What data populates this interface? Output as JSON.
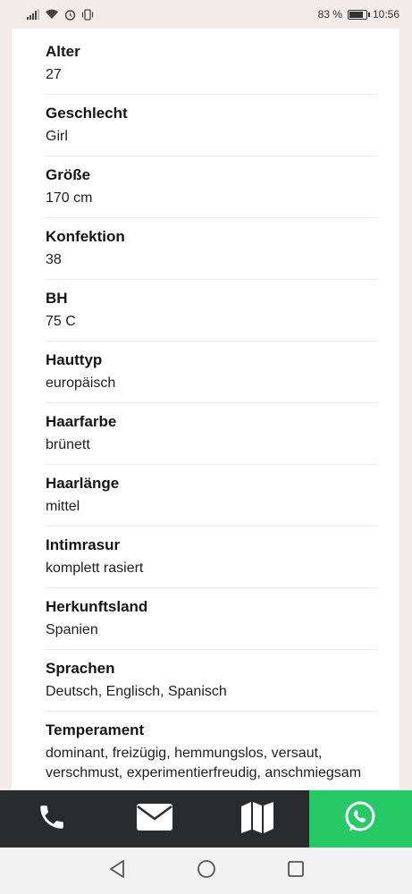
{
  "status_bar": {
    "battery_percent": "83 %",
    "time": "10:56",
    "battery_level": 0.83,
    "icons": [
      "signal-icon",
      "wifi-icon",
      "alarm-icon",
      "vibrate-icon",
      "battery-icon"
    ]
  },
  "attributes": [
    {
      "label": "Alter",
      "value": "27"
    },
    {
      "label": "Geschlecht",
      "value": "Girl"
    },
    {
      "label": "Größe",
      "value": "170 cm"
    },
    {
      "label": "Konfektion",
      "value": "38"
    },
    {
      "label": "BH",
      "value": "75 C"
    },
    {
      "label": "Hauttyp",
      "value": "europäisch"
    },
    {
      "label": "Haarfarbe",
      "value": "brünett"
    },
    {
      "label": "Haarlänge",
      "value": "mittel"
    },
    {
      "label": "Intimrasur",
      "value": "komplett rasiert"
    },
    {
      "label": "Herkunftsland",
      "value": "Spanien"
    },
    {
      "label": "Sprachen",
      "value": "Deutsch, Englisch, Spanisch"
    },
    {
      "label": "Temperament",
      "value": "dominant, freizügig, hemmungslos, versaut, verschmust, experimentierfreudig, anschmiegsam"
    }
  ],
  "action_bar": {
    "icons": [
      "phone-icon",
      "mail-icon",
      "map-icon",
      "whatsapp-icon"
    ],
    "colors": {
      "dark": "#2a2b2c",
      "whatsapp": "#25c965"
    }
  },
  "nav_bar": {
    "icons": [
      "back-icon",
      "home-icon",
      "recents-icon"
    ]
  }
}
